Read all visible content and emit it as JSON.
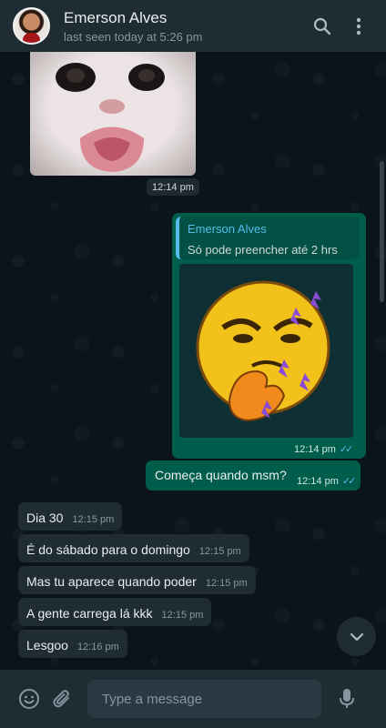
{
  "header": {
    "contact_name": "Emerson Alves",
    "status": "last seen today at 5:26 pm",
    "icons": [
      "search-icon",
      "menu-icon"
    ]
  },
  "messages": {
    "image_time": "12:14 pm",
    "reply": {
      "quoted_name": "Emerson Alves",
      "quoted_text": "Só pode preencher até 2 hrs",
      "time": "12:14 pm"
    },
    "out_text": {
      "text": "Começa quando msm?",
      "time": "12:14 pm"
    },
    "incoming": [
      {
        "text": "Dia 30",
        "time": "12:15 pm"
      },
      {
        "text": "É do sábado para o domingo",
        "time": "12:15 pm"
      },
      {
        "text": "Mas tu aparece quando poder",
        "time": "12:15 pm"
      },
      {
        "text": "A gente carrega lá kkk",
        "time": "12:15 pm"
      },
      {
        "text": "Lesgoo",
        "time": "12:16 pm"
      }
    ]
  },
  "footer": {
    "input_placeholder": "Type a message",
    "icons": [
      "emoji-icon",
      "attach-icon",
      "mic-icon"
    ]
  },
  "colors": {
    "header_bg": "#202c33",
    "outgoing_bubble": "#005c4b",
    "incoming_bubble": "#202c33",
    "read_ticks": "#53bdeb"
  }
}
